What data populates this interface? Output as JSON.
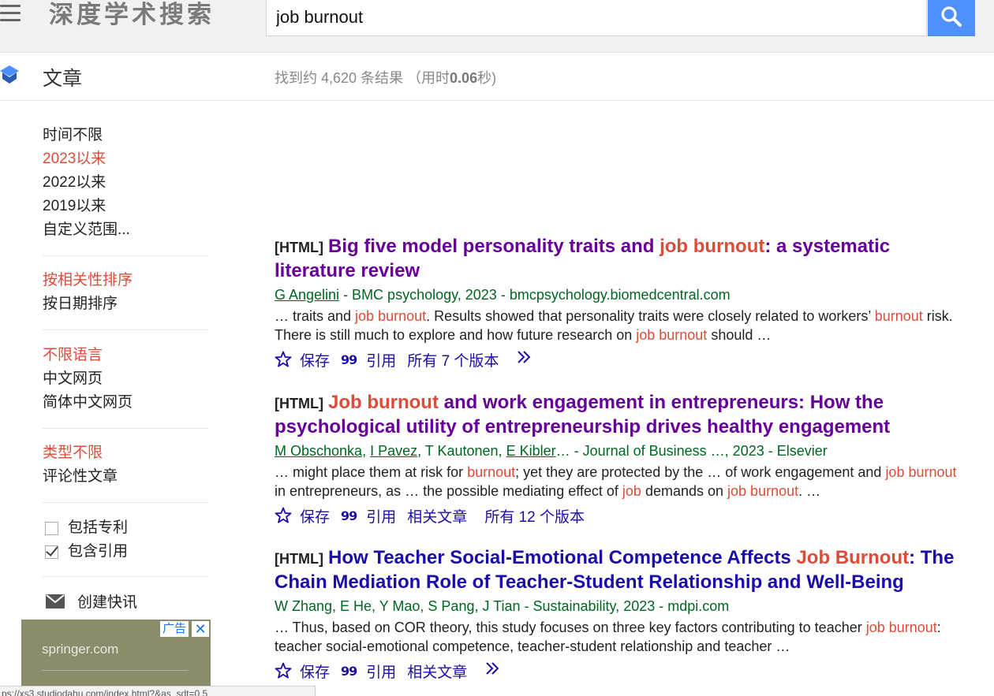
{
  "header": {
    "logo": "深度学术搜索",
    "search_value": "job burnout"
  },
  "subheader": {
    "section": "文章",
    "stats_prefix": "找到约 4,620 条结果  （用时",
    "stats_time": "0.06",
    "stats_suffix": "秒)"
  },
  "sidebar": {
    "time": [
      "时间不限",
      "2023以来",
      "2022以来",
      "2019以来",
      "自定义范围..."
    ],
    "sort": [
      "按相关性排序",
      "按日期排序"
    ],
    "lang": [
      "不限语言",
      "中文网页",
      "简体中文网页"
    ],
    "type": [
      "类型不限",
      "评论性文章"
    ],
    "include_patents": "包括专利",
    "include_citations": "包含引用",
    "alert": "创建快讯"
  },
  "ad": {
    "text": "springer.com",
    "label": "广告",
    "close": "✕"
  },
  "statusbar": "ps://xs3.studiodahu.com/index.html?&as_sdt=0,5",
  "results": [
    {
      "tag": "[HTML]",
      "title_pre": "Big five model personality traits and ",
      "title_hl": "job burnout",
      "title_post": ": a systematic literature review",
      "authors": [
        "G Angelini"
      ],
      "source": " - BMC psychology, 2023 - bmcpsychology.biomedcentral.com",
      "snippet": [
        {
          "t": "… traits and ",
          "h": false
        },
        {
          "t": "job burnout",
          "h": true
        },
        {
          "t": ". Results showed that personality traits were closely related to workers’ ",
          "h": false
        },
        {
          "t": "burnout",
          "h": true
        },
        {
          "t": " risk. There is still much to explore and how future research on ",
          "h": false
        },
        {
          "t": "job burnout",
          "h": true
        },
        {
          "t": " should …",
          "h": false
        }
      ],
      "save": "保存",
      "cite": "引用",
      "links": [
        "所有 7 个版本"
      ]
    },
    {
      "tag": "[HTML]",
      "title_pre": "",
      "title_hl": "Job burnout",
      "title_post": " and work engagement in entrepreneurs: How the psychological utility of entrepreneurship drives healthy engagement",
      "authors": [
        "M Obschonka",
        "I Pavez",
        "T Kautonen",
        "E Kibler"
      ],
      "source": "… - Journal of Business …, 2023 - Elsevier",
      "snippet": [
        {
          "t": "… might place them at risk for ",
          "h": false
        },
        {
          "t": "burnout",
          "h": true
        },
        {
          "t": "; yet they are protected by the … of work engagement and ",
          "h": false
        },
        {
          "t": "job burnout",
          "h": true
        },
        {
          "t": " in entrepreneurs, as … the possible mediating effect of ",
          "h": false
        },
        {
          "t": "job",
          "h": true
        },
        {
          "t": " demands on ",
          "h": false
        },
        {
          "t": "job burnout",
          "h": true
        },
        {
          "t": ". …",
          "h": false
        }
      ],
      "save": "保存",
      "cite": "引用",
      "links": [
        "相关文章",
        "所有 12 个版本"
      ]
    },
    {
      "tag": "[HTML]",
      "title_pre": "How Teacher Social-Emotional Competence Affects ",
      "title_hl": "Job Burnout",
      "title_post": ": The Chain Mediation Role of Teacher-Student Relationship and Well-Being",
      "authors": [],
      "source": "W Zhang, E He, Y Mao, S Pang, J Tian - Sustainability, 2023 - mdpi.com",
      "snippet": [
        {
          "t": "… Thus, based on COR theory, this study focuses on three key factors contributing to teacher ",
          "h": false
        },
        {
          "t": "job burnout",
          "h": true
        },
        {
          "t": ": teacher social-emotional competence, teacher-student relationship and teacher …",
          "h": false
        }
      ],
      "save": "保存",
      "cite": "引用",
      "links": [
        "相关文章"
      ]
    }
  ]
}
